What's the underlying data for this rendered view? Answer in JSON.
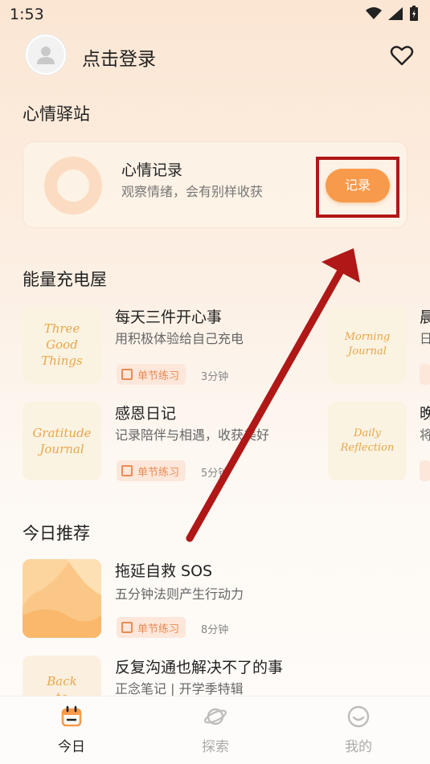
{
  "status_bar": {
    "time": "1:53"
  },
  "header": {
    "login_text": "点击登录"
  },
  "mood_station": {
    "section_title": "心情驿站",
    "card_title": "心情记录",
    "card_subtitle": "观察情绪，会有别样收获",
    "record_button": "记录"
  },
  "energy_room": {
    "section_title": "能量充电屋",
    "items": [
      {
        "thumb_text": "Three\nGood\nThings",
        "title": "每天三件开心事",
        "subtitle": "用积极体验给自己充电",
        "tag": "单节练习",
        "duration": "3分钟"
      },
      {
        "thumb_text": "Morning\nJournal",
        "title": "晨",
        "subtitle": "日"
      },
      {
        "thumb_text": "Gratitude\nJournal",
        "title": "感恩日记",
        "subtitle": "记录陪伴与相遇，收获美好",
        "tag": "单节练习",
        "duration": "5分钟"
      },
      {
        "thumb_text": "Daily\nReflection",
        "title": "晚",
        "subtitle": "将"
      }
    ]
  },
  "today": {
    "section_title": "今日推荐",
    "items": [
      {
        "title": "拖延自救 SOS",
        "subtitle": "五分钟法则产生行动力",
        "tag": "单节练习",
        "duration": "8分钟"
      },
      {
        "thumb_text": "Back\nto",
        "title": "反复沟通也解决不了的事",
        "subtitle": "正念笔记 | 开学季特辑"
      }
    ]
  },
  "bottom_nav": {
    "tabs": [
      {
        "label": "今日",
        "active": true
      },
      {
        "label": "探索",
        "active": false
      },
      {
        "label": "我的",
        "active": false
      }
    ]
  },
  "colors": {
    "accent": "#f89a4b",
    "annotation": "#b01717",
    "tag_bg": "#fde7da",
    "tag_text": "#e88b54"
  }
}
